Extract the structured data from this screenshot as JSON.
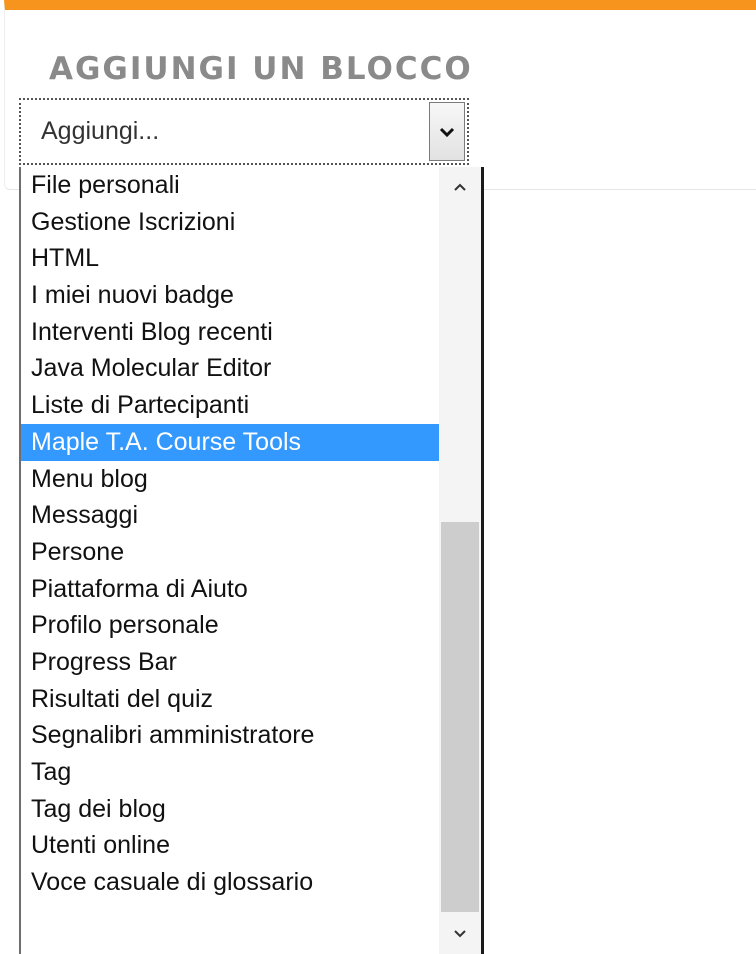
{
  "block": {
    "title": "AGGIUNGI UN BLOCCO",
    "accent_color": "#f7941d"
  },
  "select": {
    "value": "Aggiungi...",
    "arrow_icon": "chevron-down-icon"
  },
  "dropdown": {
    "selected_index": 7,
    "selected_color": "#3399ff",
    "items": [
      "File personali",
      "Gestione Iscrizioni",
      "HTML",
      "I miei nuovi badge",
      "Interventi Blog recenti",
      "Java Molecular Editor",
      "Liste di Partecipanti",
      "Maple T.A. Course Tools",
      "Menu blog",
      "Messaggi",
      "Persone",
      "Piattaforma di Aiuto",
      "Profilo personale",
      "Progress Bar",
      "Risultati del quiz",
      "Segnalibri amministratore",
      "Tag",
      "Tag dei blog",
      "Utenti online",
      "Voce casuale di glossario"
    ],
    "scroll_icons": [
      "scroll-up-icon",
      "scroll-down-icon"
    ]
  }
}
